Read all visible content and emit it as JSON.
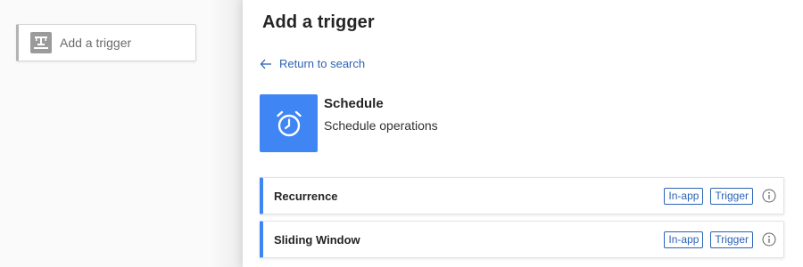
{
  "canvas": {
    "trigger_card_label": "Add a trigger",
    "trigger_card_icon": "trigger-placeholder-icon"
  },
  "panel": {
    "title": "Add a trigger",
    "return_link": "Return to search",
    "return_icon": "arrow-left-icon",
    "connector": {
      "name": "Schedule",
      "description": "Schedule operations",
      "icon": "alarm-clock-icon",
      "color": "#3f85f4"
    },
    "operations": [
      {
        "name": "Recurrence",
        "badges": [
          "In-app",
          "Trigger"
        ],
        "info_icon": "info-icon"
      },
      {
        "name": "Sliding Window",
        "badges": [
          "In-app",
          "Trigger"
        ],
        "info_icon": "info-icon"
      }
    ]
  },
  "colors": {
    "accent": "#3f85f4",
    "link": "#2b63b6"
  }
}
